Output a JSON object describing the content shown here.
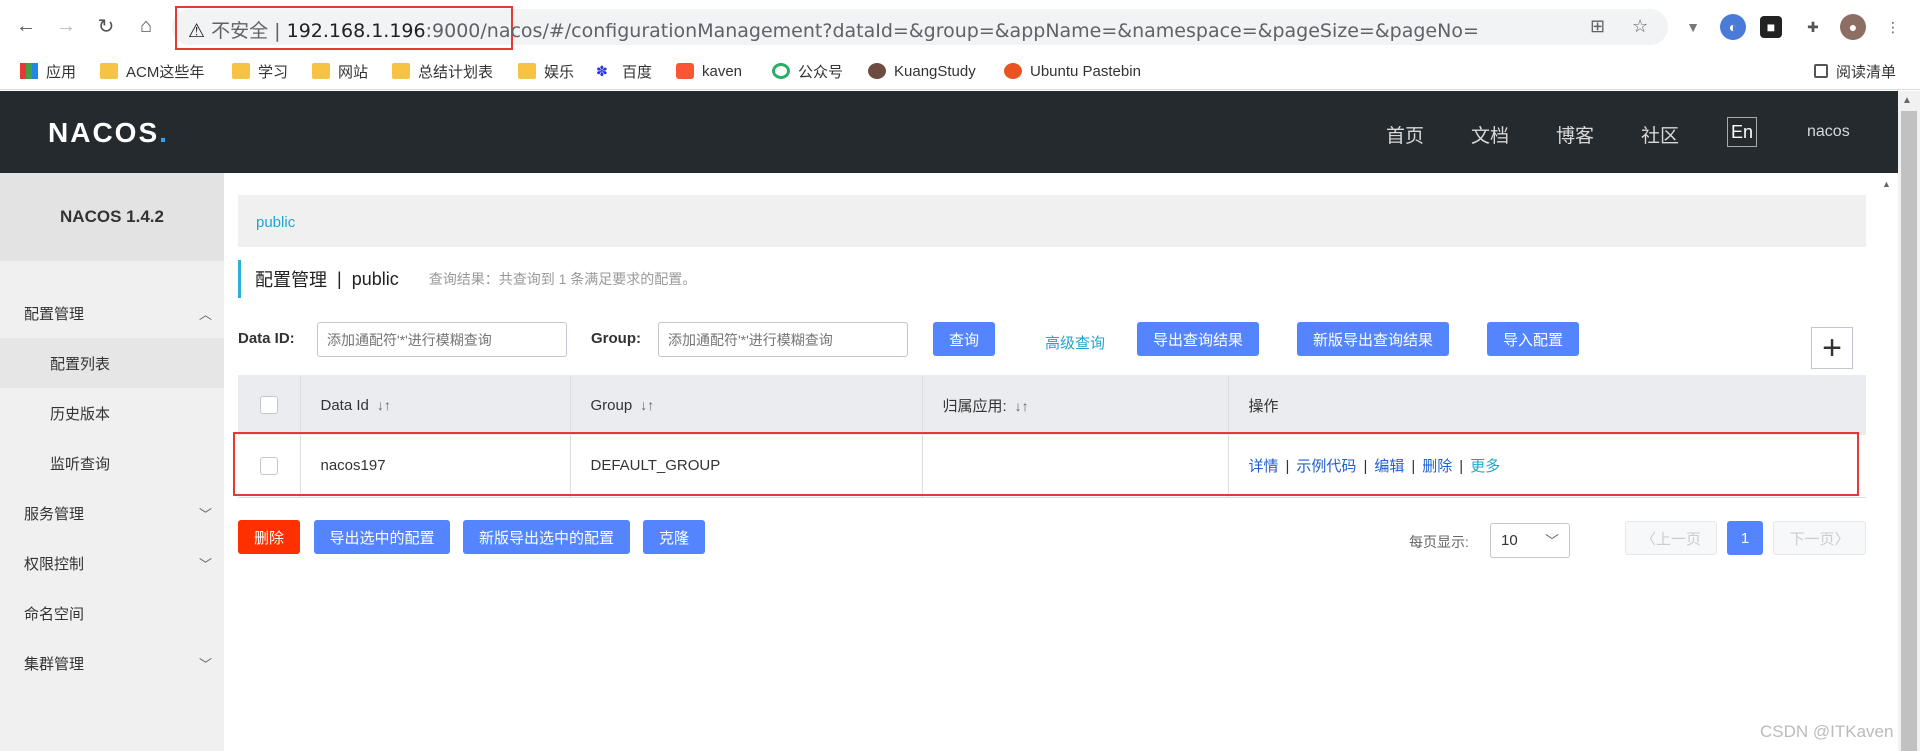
{
  "browser": {
    "address": {
      "insecure_label": "不安全",
      "separator": "|",
      "host": "192.168.1.196",
      "port_path": ":9000/nacos",
      "rest": "/#/configurationManagement?dataId=&group=&appName=&namespace=&pageSize=&pageNo="
    },
    "bookmarks": [
      {
        "label": "应用",
        "icon": "apps-grid-icon"
      },
      {
        "label": "ACM这些年",
        "icon": "folder-icon"
      },
      {
        "label": "学习",
        "icon": "folder-icon"
      },
      {
        "label": "网站",
        "icon": "folder-icon"
      },
      {
        "label": "总结计划表",
        "icon": "folder-icon"
      },
      {
        "label": "娱乐",
        "icon": "folder-icon"
      },
      {
        "label": "百度",
        "icon": "baidu-icon"
      },
      {
        "label": "kaven",
        "icon": "csdn-icon"
      },
      {
        "label": "公众号",
        "icon": "wechat-icon"
      },
      {
        "label": "KuangStudy",
        "icon": "kuang-icon"
      },
      {
        "label": "Ubuntu Pastebin",
        "icon": "ubuntu-icon"
      }
    ],
    "reading_list": "阅读清单"
  },
  "header": {
    "logo": "NACOS",
    "nav": [
      "首页",
      "文档",
      "博客",
      "社区"
    ],
    "lang": "En",
    "user": "nacos"
  },
  "sidebar": {
    "version": "NACOS 1.4.2",
    "items": [
      {
        "label": "配置管理",
        "expanded": true
      },
      {
        "label": "配置列表",
        "sub": true
      },
      {
        "label": "历史版本",
        "sub": true
      },
      {
        "label": "监听查询",
        "sub": true
      },
      {
        "label": "服务管理"
      },
      {
        "label": "权限控制"
      },
      {
        "label": "命名空间"
      },
      {
        "label": "集群管理"
      }
    ]
  },
  "main": {
    "namespace_tab": "public",
    "title": "配置管理",
    "title_sep": "|",
    "title_ns": "public",
    "query_result": "查询结果：共查询到 1 条满足要求的配置。",
    "filters": {
      "dataid_label": "Data ID:",
      "dataid_placeholder": "添加通配符'*'进行模糊查询",
      "group_label": "Group:",
      "group_placeholder": "添加通配符'*'进行模糊查询"
    },
    "buttons": {
      "query": "查询",
      "advanced": "高级查询",
      "export": "导出查询结果",
      "export_new": "新版导出查询结果",
      "import": "导入配置",
      "add": "+"
    },
    "table": {
      "headers": [
        "Data Id",
        "Group",
        "归属应用:",
        "操作"
      ],
      "sort_icon": "↓↑",
      "rows": [
        {
          "data_id": "nacos197",
          "group": "DEFAULT_GROUP",
          "app": ""
        }
      ],
      "ops": [
        "详情",
        "示例代码",
        "编辑",
        "删除",
        "更多"
      ],
      "op_sep": "|"
    },
    "bottom_buttons": {
      "delete": "删除",
      "export_selected": "导出选中的配置",
      "export_selected_new": "新版导出选中的配置",
      "clone": "克隆"
    },
    "pager": {
      "label": "每页显示:",
      "page_size": "10",
      "prev": "上一页",
      "current": "1",
      "next": "下一页"
    }
  },
  "watermark": "CSDN @ITKaven",
  "colors": {
    "header_bg": "#252a2f",
    "primary": "#5584ff",
    "danger": "#ff3000",
    "link": "#1fa6ce",
    "highlight": "#e53935"
  }
}
